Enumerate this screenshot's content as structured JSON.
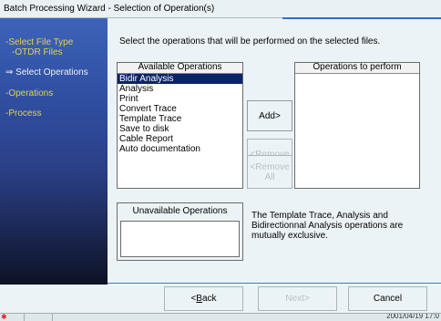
{
  "window": {
    "title": "Batch Processing Wizard - Selection of Operation(s)"
  },
  "sidebar": {
    "steps": [
      {
        "label": "-Select File Type",
        "sub": "-OTDR Files"
      },
      {
        "label": "⇒ Select Operations"
      },
      {
        "label": "-Operations"
      },
      {
        "label": "-Process"
      }
    ]
  },
  "main": {
    "instruction": "Select the operations that will be performed on the selected files.",
    "available": {
      "header": "Available Operations",
      "items": [
        "Bidir Analysis",
        "Analysis",
        "Print",
        "Convert Trace",
        "Template Trace",
        "Save to disk",
        "Cable Report",
        "Auto documentation"
      ],
      "selected_index": 0
    },
    "to_perform": {
      "header": "Operations to perform",
      "items": []
    },
    "buttons": {
      "add": "Add>",
      "remove": "<Remove",
      "remove_all_line1": "<Remove",
      "remove_all_line2": "All"
    },
    "unavailable": {
      "label": "Unavailable Operations",
      "items": []
    },
    "note": "The Template Trace, Analysis and Bidirectionnal Analysis operations are mutually exclusive."
  },
  "footer": {
    "back_prefix": "<",
    "back_underline": "B",
    "back_rest": "ack",
    "next": "Next>",
    "cancel": "Cancel"
  },
  "statusbar": {
    "datetime": "2001/04/19 17:0"
  },
  "colors": {
    "accent": "#2f6fd1",
    "selection": "#0a246a",
    "step_active": "#e3d24a"
  }
}
